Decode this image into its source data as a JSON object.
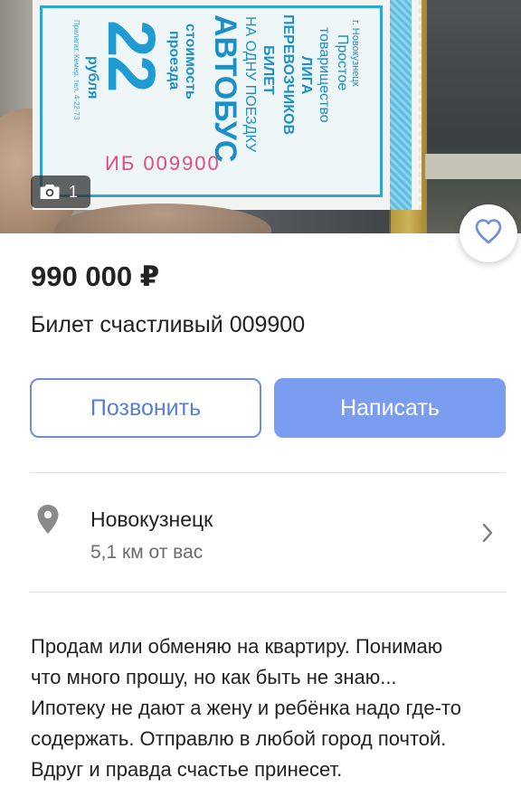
{
  "photo": {
    "counter": "1",
    "camera_icon": "camera-icon",
    "ticket": {
      "city": "г. Новокузнецк",
      "line1": "Простое",
      "line2": "товарищество",
      "line3": "ЛИГА",
      "line4": "ПЕРЕВОЗЧИКОВ",
      "line5": "БИЛЕТ",
      "line6": "НА ОДНУ ПОЕЗДКУ",
      "bus": "АВТОБУС",
      "cost1": "стоимость",
      "cost2": "проезда",
      "price": "22",
      "currency": "рубля",
      "print": "Прилагат. Кемер. тел. 4-22-73",
      "serial": "ИБ 009900"
    }
  },
  "favorite_icon": "heart-icon",
  "listing": {
    "price": "990 000 ₽",
    "title": "Билет счастливый 009900"
  },
  "actions": {
    "call_label": "Позвонить",
    "write_label": "Написать"
  },
  "location": {
    "city": "Новокузнецк",
    "distance": "5,1 км от вас"
  },
  "description": {
    "lines": [
      "Продам или обменяю на квартиру. Понимаю",
      "что много прошу, но как быть не знаю...",
      "Ипотеку не дают а жену и ребёнка надо где-то",
      "содержать. Отправлю в любой город почтой.",
      "Вдруг и правда счастье принесет."
    ]
  },
  "colors": {
    "accent": "#7a9df0",
    "accent_border": "#6f90d8",
    "ticket_blue": "#1f9bd3",
    "serial_pink": "#e44a7c"
  }
}
